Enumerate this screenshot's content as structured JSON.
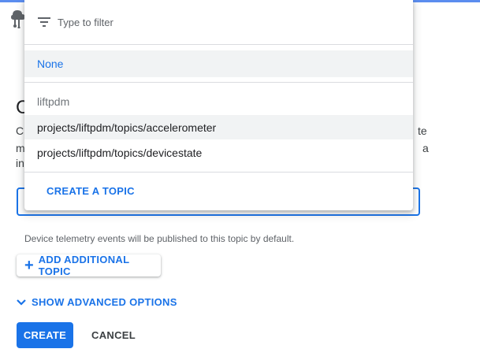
{
  "page": {
    "heading_fragment": "C",
    "desc_left_fragments": [
      "Cl",
      "m",
      "in"
    ],
    "desc_right_fragments": [
      "te",
      "a"
    ],
    "helper_text": "Device telemetry events will be published to this topic by default.",
    "add_topic_label": "ADD ADDITIONAL TOPIC",
    "advanced_label": "SHOW ADVANCED OPTIONS",
    "create_label": "CREATE",
    "cancel_label": "CANCEL"
  },
  "dropdown": {
    "filter_placeholder": "Type to filter",
    "none_label": "None",
    "group_label": "liftpdm",
    "options": [
      "projects/liftpdm/topics/accelerometer",
      "projects/liftpdm/topics/devicestate"
    ],
    "create_topic_label": "CREATE A TOPIC"
  },
  "icons": {
    "filter": "filter-list-icon",
    "plus": "add-icon",
    "chevron": "chevron-down-icon",
    "app": "iot-core-icon"
  },
  "colors": {
    "accent": "#1a73e8",
    "highlight": "#f1f3f4",
    "text": "#202124",
    "secondary_text": "#5f6368"
  }
}
